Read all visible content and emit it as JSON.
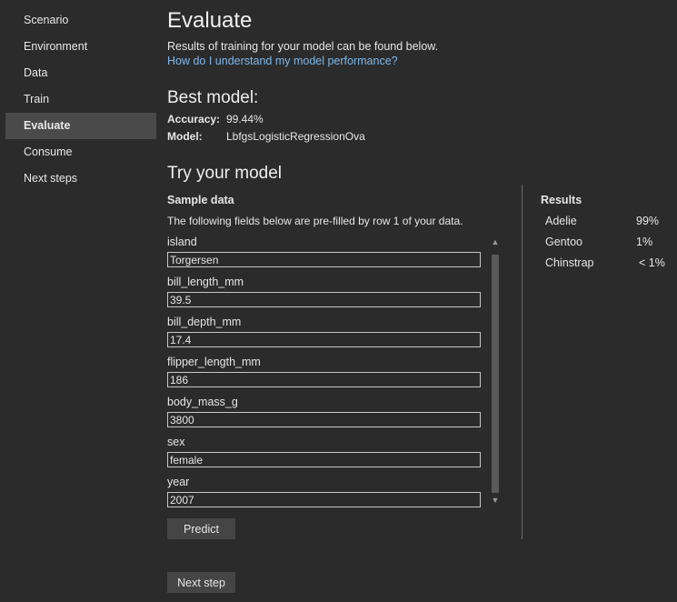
{
  "sidebar": {
    "items": [
      {
        "label": "Scenario"
      },
      {
        "label": "Environment"
      },
      {
        "label": "Data"
      },
      {
        "label": "Train"
      },
      {
        "label": "Evaluate"
      },
      {
        "label": "Consume"
      },
      {
        "label": "Next steps"
      }
    ],
    "active": "Evaluate"
  },
  "main": {
    "title": "Evaluate",
    "subtitle": "Results of training for your model can be found below.",
    "help_link": "How do I understand my model performance?",
    "best_model": {
      "heading": "Best model:",
      "accuracy_label": "Accuracy:",
      "accuracy_value": "99.44%",
      "model_label": "Model:",
      "model_value": "LbfgsLogisticRegressionOva"
    },
    "try_model": {
      "heading": "Try your model",
      "sample_label": "Sample data",
      "description": "The following fields below are pre-filled by row 1 of your data.",
      "fields": [
        {
          "label": "island",
          "value": "Torgersen"
        },
        {
          "label": "bill_length_mm",
          "value": "39.5"
        },
        {
          "label": "bill_depth_mm",
          "value": "17.4"
        },
        {
          "label": "flipper_length_mm",
          "value": "186"
        },
        {
          "label": "body_mass_g",
          "value": "3800"
        },
        {
          "label": "sex",
          "value": "female"
        },
        {
          "label": "year",
          "value": "2007"
        }
      ],
      "predict_label": "Predict"
    },
    "results": {
      "heading": "Results",
      "rows": [
        {
          "name": "Adelie",
          "value": "99%"
        },
        {
          "name": "Gentoo",
          "value": "1%"
        },
        {
          "name": "Chinstrap",
          "value": "< 1%"
        }
      ]
    },
    "next_step_label": "Next step"
  }
}
